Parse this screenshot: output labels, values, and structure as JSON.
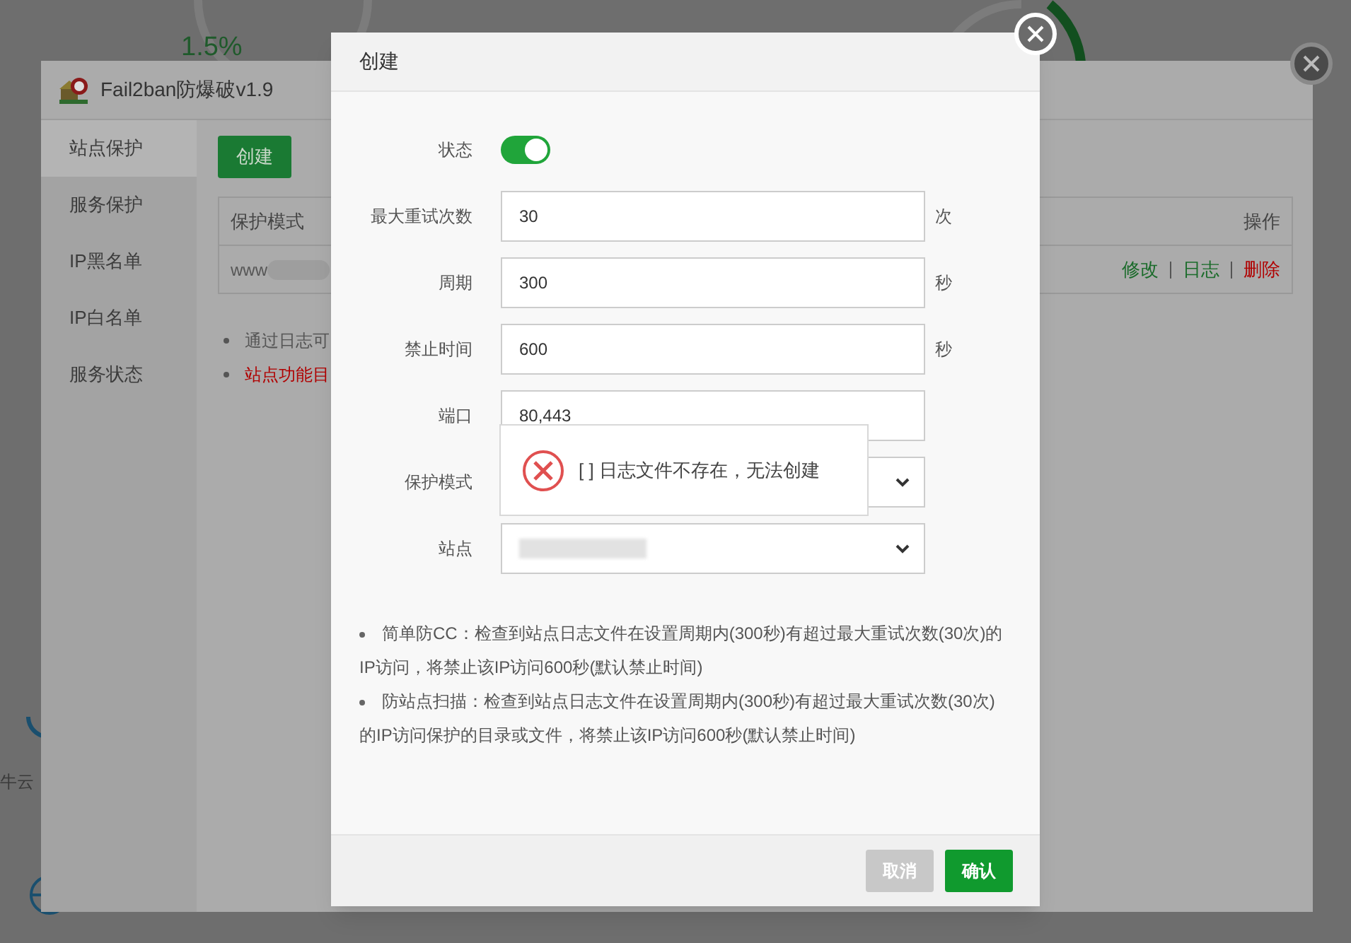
{
  "background": {
    "gauge_reading": "1.5%",
    "side_text": "牛云"
  },
  "plugin_window": {
    "title": "Fail2ban防爆破v1.9",
    "sidebar": [
      {
        "label": "站点保护",
        "selected": true
      },
      {
        "label": "服务保护",
        "selected": false
      },
      {
        "label": "IP黑名单",
        "selected": false
      },
      {
        "label": "IP白名单",
        "selected": false
      },
      {
        "label": "服务状态",
        "selected": false
      }
    ],
    "create_button": "创建",
    "table": {
      "columns": [
        "保护模式",
        "操作"
      ],
      "rows": [
        {
          "site": "www",
          "actions": [
            {
              "label": "修改",
              "kind": "normal"
            },
            {
              "label": "日志",
              "kind": "normal"
            },
            {
              "label": "删除",
              "kind": "danger"
            }
          ]
        }
      ]
    },
    "notes": [
      {
        "text": "通过日志可",
        "kind": "normal"
      },
      {
        "text": "站点功能目",
        "kind": "warning"
      }
    ]
  },
  "dialog": {
    "title": "创建",
    "fields": [
      {
        "label": "状态",
        "kind": "switch",
        "on": true
      },
      {
        "label": "最大重试次数",
        "kind": "input",
        "value": "30",
        "unit": "次"
      },
      {
        "label": "周期",
        "kind": "input",
        "value": "300",
        "unit": "秒"
      },
      {
        "label": "禁止时间",
        "kind": "input",
        "value": "600",
        "unit": "秒"
      },
      {
        "label": "端口",
        "kind": "input",
        "value": "80,443"
      },
      {
        "label": "保护模式",
        "kind": "select"
      },
      {
        "label": "站点",
        "kind": "select",
        "blurred": true
      }
    ],
    "toast": {
      "message": "[ ] 日志文件不存在，无法创建"
    },
    "notes": [
      "简单防CC：检查到站点日志文件在设置周期内(300秒)有超过最大重试次数(30次)的IP访问，将禁止该IP访问600秒(默认禁止时间)",
      "防站点扫描：检查到站点日志文件在设置周期内(300秒)有超过最大重试次数(30次)的IP访问保护的目录或文件，将禁止该IP访问600秒(默认禁止时间)"
    ],
    "buttons": [
      {
        "label": "取消",
        "kind": "secondary"
      },
      {
        "label": "确认",
        "kind": "primary"
      }
    ]
  }
}
